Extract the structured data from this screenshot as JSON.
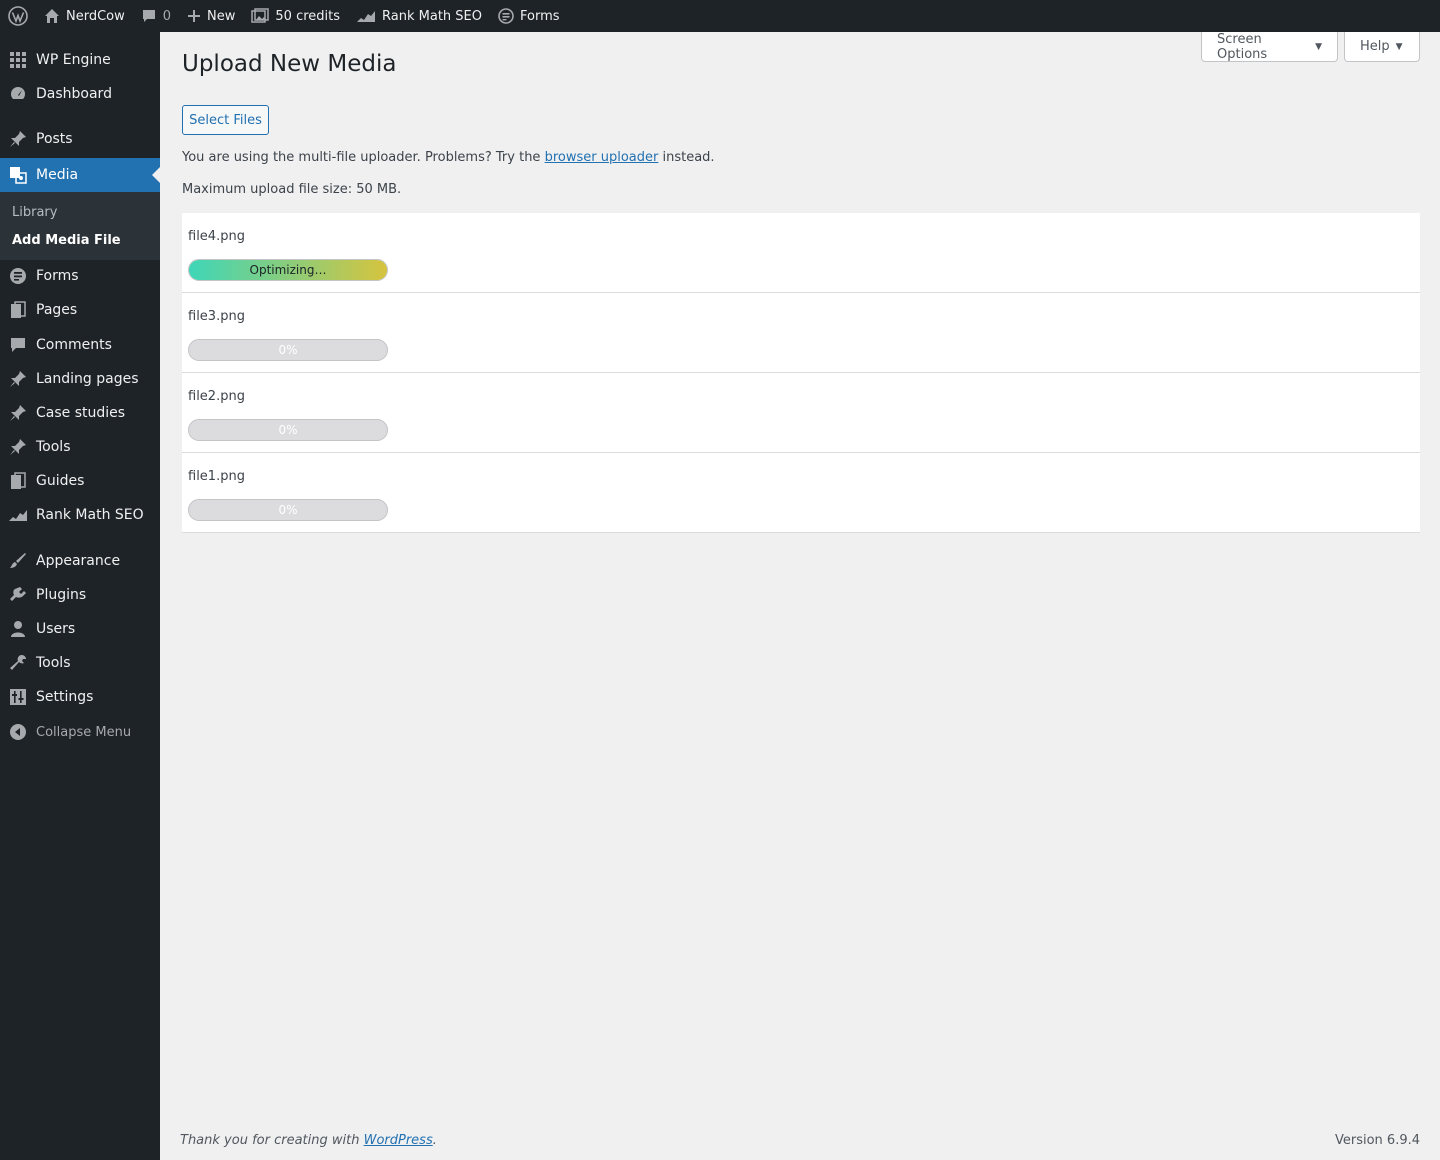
{
  "adminbar": {
    "site_name": "NerdCow",
    "comments_count": "0",
    "new_label": "New",
    "credits_label": "50 credits",
    "rankmath_label": "Rank Math SEO",
    "forms_label": "Forms"
  },
  "sidebar": {
    "items": [
      {
        "label": "WP Engine",
        "icon": "grid-icon"
      },
      {
        "label": "Dashboard",
        "icon": "dashboard-icon"
      },
      {
        "label": "Posts",
        "icon": "pin-icon"
      },
      {
        "label": "Media",
        "icon": "media-icon"
      },
      {
        "label": "Forms",
        "icon": "forms-icon"
      },
      {
        "label": "Pages",
        "icon": "pages-icon"
      },
      {
        "label": "Comments",
        "icon": "comment-icon"
      },
      {
        "label": "Landing pages",
        "icon": "pin-icon"
      },
      {
        "label": "Case studies",
        "icon": "pin-icon"
      },
      {
        "label": "Tools",
        "icon": "pin-icon"
      },
      {
        "label": "Guides",
        "icon": "book-icon"
      },
      {
        "label": "Rank Math SEO",
        "icon": "chart-icon"
      },
      {
        "label": "Appearance",
        "icon": "brush-icon"
      },
      {
        "label": "Plugins",
        "icon": "plug-icon"
      },
      {
        "label": "Users",
        "icon": "user-icon"
      },
      {
        "label": "Tools",
        "icon": "wrench-icon"
      },
      {
        "label": "Settings",
        "icon": "settings-icon"
      }
    ],
    "submenu": {
      "library": "Library",
      "add_media": "Add Media File"
    },
    "collapse_label": "Collapse Menu"
  },
  "header": {
    "screen_options": "Screen Options",
    "help": "Help"
  },
  "page": {
    "title": "Upload New Media",
    "select_files": "Select Files",
    "uploader_text_before": "You are using the multi-file uploader. Problems? Try the",
    "uploader_link": "browser uploader",
    "uploader_text_after": "instead.",
    "max_size": "Maximum upload file size: 50 MB."
  },
  "uploads": [
    {
      "name": "file4.png",
      "status": "Optimizing…",
      "progress": 1.0
    },
    {
      "name": "file3.png",
      "status": "0%",
      "progress": 0
    },
    {
      "name": "file2.png",
      "status": "0%",
      "progress": 0
    },
    {
      "name": "file1.png",
      "status": "0%",
      "progress": 0
    }
  ],
  "footer": {
    "thanks_before": "Thank you for creating with",
    "thanks_link": "WordPress",
    "thanks_after": ".",
    "version": "Version 6.9.4"
  },
  "colors": {
    "accent": "#2271b1",
    "sidebar_bg": "#1d2327",
    "progress_start": "#3ed6b8",
    "progress_end": "#d6c43e"
  }
}
